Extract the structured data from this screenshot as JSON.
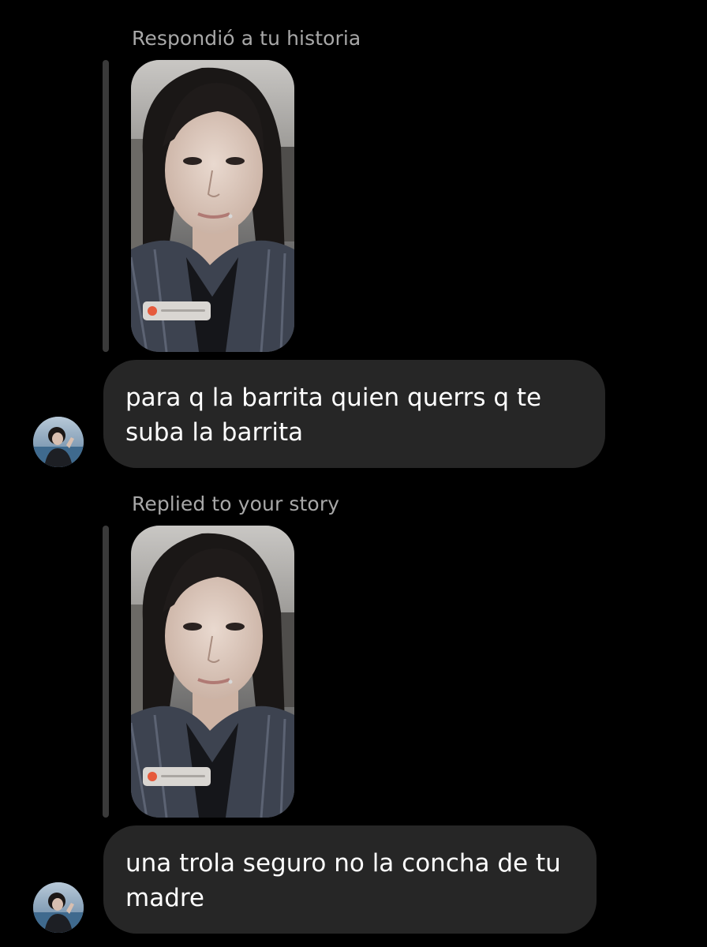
{
  "conversation": {
    "messages": [
      {
        "reply_label": "Respondió a tu historia",
        "story_thumbnail": "story-selfie-image",
        "text": "para q la barrita quien querrs q te suba la barrita",
        "avatar": "profile-avatar-image"
      },
      {
        "reply_label": "Replied to your story",
        "story_thumbnail": "story-selfie-image",
        "text": "una trola seguro no la concha de tu madre",
        "avatar": "profile-avatar-image"
      }
    ]
  }
}
